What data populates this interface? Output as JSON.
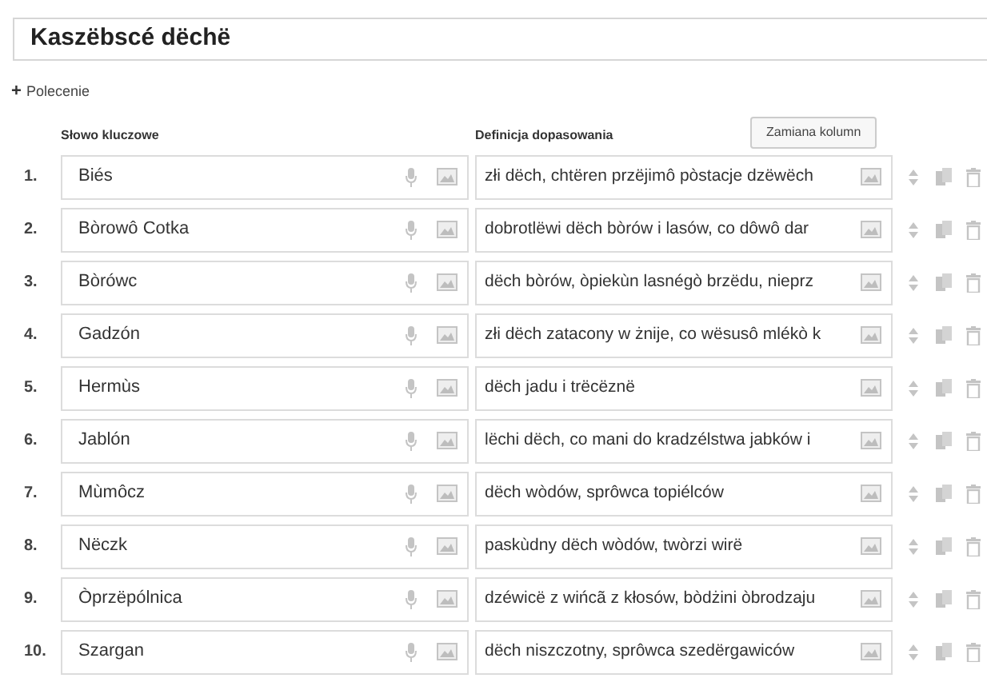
{
  "title_field": {
    "value": "Kaszëbscé dëchë"
  },
  "add_instruction": {
    "icon": "+",
    "label": "Polecenie"
  },
  "columns": [
    "Słowo kluczowe",
    "Definicja dopasowania"
  ],
  "swap_button": "Zamiana kolumn",
  "rows": [
    {
      "number": "1.",
      "keyword": "Biés",
      "definition": "złi dëch, chtëren przëjimô pòstacje dzëwëch"
    },
    {
      "number": "2.",
      "keyword": "Bòrowô Cotka",
      "definition": "dobrotlëwi dëch bòrów i lasów, co dôwô dar"
    },
    {
      "number": "3.",
      "keyword": "Bòrówc",
      "definition": "dëch bòrów, òpiekùn lasnégò brzëdu, nieprz"
    },
    {
      "number": "4.",
      "keyword": "Gadzón",
      "definition": "złi dëch zatacony w żnije, co wësusô mlékò k"
    },
    {
      "number": "5.",
      "keyword": "Hermùs",
      "definition": "dëch jadu i trëcëznë"
    },
    {
      "number": "6.",
      "keyword": "Jablón",
      "definition": "lëchi dëch, co mani do kradzélstwa jabków i"
    },
    {
      "number": "7.",
      "keyword": "Mùmôcz",
      "definition": "dëch wòdów, sprôwca topiélców"
    },
    {
      "number": "8.",
      "keyword": "Nëczk",
      "definition": "paskùdny dëch wòdów, twòrzi wirë"
    },
    {
      "number": "9.",
      "keyword": "Òprzëpólnica",
      "definition": "dzéwicë z wińcã z kłosów, bòdżini òbrodzaju"
    },
    {
      "number": "10.",
      "keyword": "Szargan",
      "definition": "dëch niszczotny, sprôwca szedërgawiców"
    }
  ]
}
